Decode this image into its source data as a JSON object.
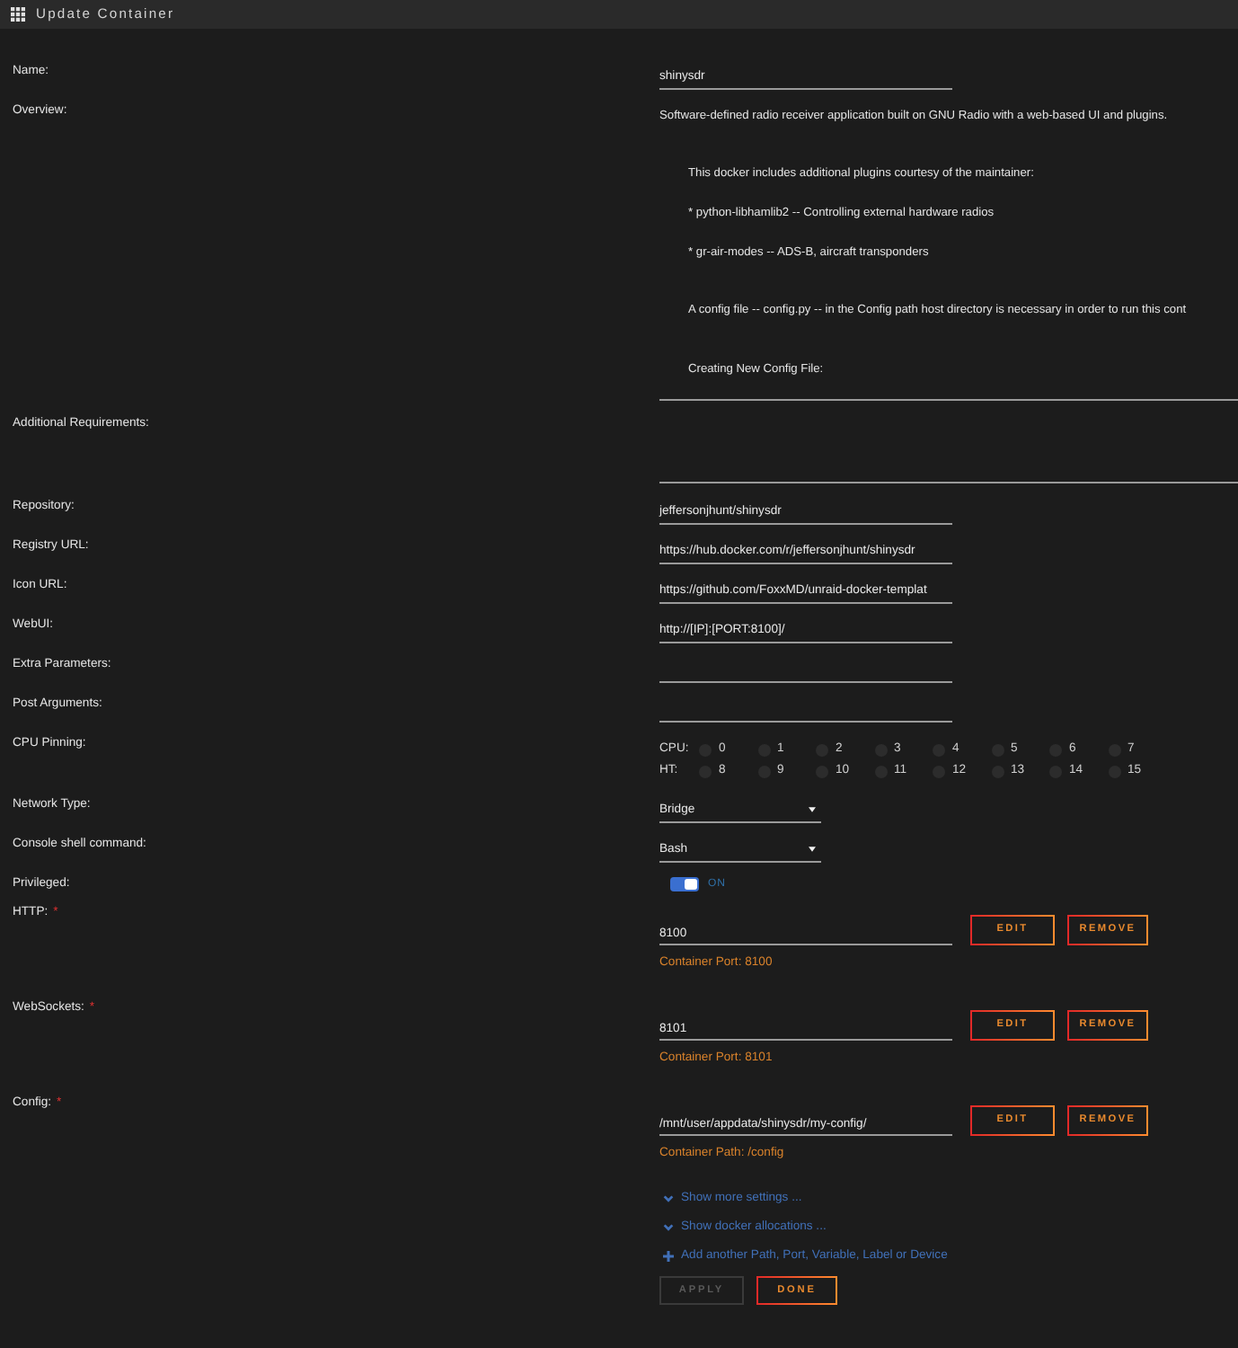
{
  "header": {
    "title": "Update Container"
  },
  "fields": [
    {
      "kind": "text",
      "label": "Name:",
      "value": "shinysdr"
    },
    {
      "kind": "overview",
      "label": "Overview:",
      "summary": "Software-defined radio receiver application built on GNU Radio with a web-based UI and plugins.",
      "details": [
        "This docker includes additional plugins courtesy of the maintainer:",
        "* python-libhamlib2 -- Controlling external hardware radios",
        "* gr-air-modes -- ADS-B, aircraft transponders",
        "A config file -- config.py -- in the Config path host directory is necessary in order to run this cont",
        "Creating New Config File:"
      ]
    },
    {
      "kind": "textarea",
      "label": "Additional Requirements:"
    },
    {
      "kind": "text",
      "label": "Repository:",
      "value": "jeffersonjhunt/shinysdr"
    },
    {
      "kind": "text",
      "label": "Registry URL:",
      "value": "https://hub.docker.com/r/jeffersonjhunt/shinysdr"
    },
    {
      "kind": "text",
      "label": "Icon URL:",
      "value": "https://github.com/FoxxMD/unraid-docker-templat"
    },
    {
      "kind": "text",
      "label": "WebUI:",
      "value": "http://[IP]:[PORT:8100]/"
    },
    {
      "kind": "text",
      "label": "Extra Parameters:"
    },
    {
      "kind": "text",
      "label": "Post Arguments:"
    },
    {
      "kind": "cpu",
      "label": "CPU Pinning:",
      "rows": [
        {
          "label": "CPU:",
          "cores": [
            {
              "number": "0",
              "checked": false
            },
            {
              "number": "1",
              "checked": false
            },
            {
              "number": "2",
              "checked": false
            },
            {
              "number": "3",
              "checked": false
            },
            {
              "number": "4",
              "checked": false
            },
            {
              "number": "5",
              "checked": false
            },
            {
              "number": "6",
              "checked": false
            },
            {
              "number": "7",
              "checked": false
            }
          ]
        },
        {
          "label": "HT:",
          "cores": [
            {
              "number": "8",
              "checked": false
            },
            {
              "number": "9",
              "checked": false
            },
            {
              "number": "10",
              "checked": false
            },
            {
              "number": "11",
              "checked": false
            },
            {
              "number": "12",
              "checked": false
            },
            {
              "number": "13",
              "checked": false
            },
            {
              "number": "14",
              "checked": false
            },
            {
              "number": "15",
              "checked": false
            }
          ]
        }
      ]
    },
    {
      "kind": "select",
      "label": "Network Type:",
      "value": "Bridge"
    },
    {
      "kind": "select",
      "label": "Console shell command:",
      "value": "Bash"
    },
    {
      "kind": "switch",
      "label": "Privileged:",
      "on": true,
      "state_text": "ON"
    },
    {
      "kind": "mapping",
      "label": "HTTP:",
      "required_mark": "*",
      "value": "8100",
      "buttons": [
        {
          "kind": "edit",
          "label": "EDIT"
        },
        {
          "kind": "remove",
          "label": "REMOVE"
        }
      ],
      "hint": "Container Port: 8100"
    },
    {
      "kind": "mapping",
      "label": "WebSockets:",
      "required_mark": "*",
      "value": "8101",
      "buttons": [
        {
          "kind": "edit",
          "label": "EDIT"
        },
        {
          "kind": "remove",
          "label": "REMOVE"
        }
      ],
      "hint": "Container Port: 8101"
    },
    {
      "kind": "mapping",
      "label": "Config:",
      "required_mark": "*",
      "value": "/mnt/user/appdata/shinysdr/my-config/",
      "buttons": [
        {
          "kind": "edit",
          "label": "EDIT"
        },
        {
          "kind": "remove",
          "label": "REMOVE"
        }
      ],
      "hint": "Container Path: /config"
    }
  ],
  "links": [
    {
      "kind": "expand",
      "text": "Show more settings ..."
    },
    {
      "kind": "expand",
      "text": "Show docker allocations ..."
    },
    {
      "kind": "add",
      "text": "Add another Path, Port, Variable, Label or Device"
    }
  ],
  "actions": [
    {
      "kind": "apply",
      "label": "APPLY",
      "disabled": true
    },
    {
      "kind": "done",
      "label": "DONE",
      "disabled": false
    }
  ]
}
